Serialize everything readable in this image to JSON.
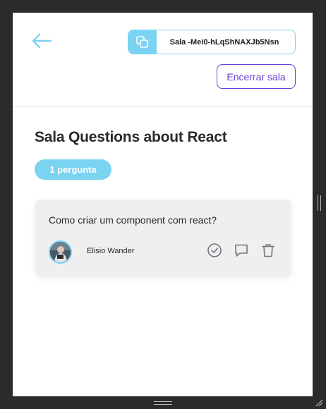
{
  "header": {
    "back_icon": "arrow-left-icon",
    "room_code": {
      "icon": "copy-icon",
      "label": "Sala -Mei0-hLqShNAXJb5Nsn"
    },
    "close_room_label": "Encerrar sala"
  },
  "main": {
    "title": "Sala Questions about React",
    "question_count_label": "1 pergunta"
  },
  "questions": [
    {
      "content": "Como criar um component com react?",
      "author": "Elisio Wander",
      "actions": [
        "check-circle-icon",
        "message-icon",
        "trash-icon"
      ]
    }
  ],
  "colors": {
    "accent": "#7bd3f2",
    "purple": "#6a3fd9",
    "card_bg": "#efefef",
    "text": "#29292e",
    "frame": "#2b2b2b"
  }
}
